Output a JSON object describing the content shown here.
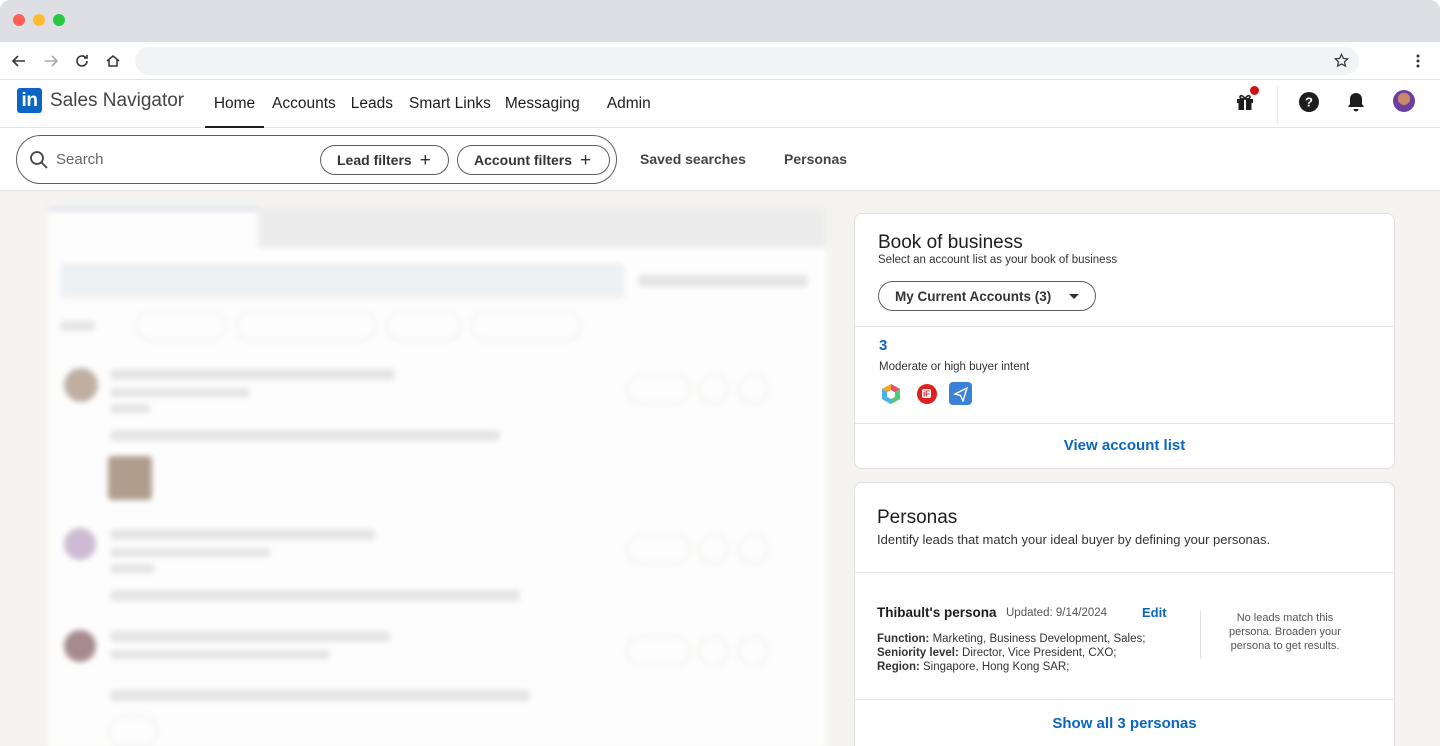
{
  "app": {
    "brand_short": "in",
    "brand_name": "Sales Navigator"
  },
  "nav": {
    "items": [
      {
        "label": "Home",
        "active": true
      },
      {
        "label": "Accounts"
      },
      {
        "label": "Leads"
      },
      {
        "label": "Smart Links"
      },
      {
        "label": "Messaging"
      },
      {
        "label": "Admin"
      }
    ]
  },
  "search": {
    "placeholder": "Search",
    "lead_filters": "Lead filters",
    "account_filters": "Account filters",
    "saved_searches": "Saved searches",
    "personas": "Personas"
  },
  "book_of_business": {
    "title": "Book of business",
    "subtitle": "Select an account list as your book of business",
    "dropdown_value": "My Current Accounts (3)",
    "count": "3",
    "intent_label": "Moderate or high buyer intent",
    "view_link": "View account list"
  },
  "personas_card": {
    "title": "Personas",
    "subtitle": "Identify leads that match your ideal buyer by defining your personas.",
    "persona_name": "Thibault's persona",
    "updated": "Updated: 9/14/2024",
    "edit": "Edit",
    "function_label": "Function:",
    "function_value": "Marketing, Business Development, Sales;",
    "seniority_label": "Seniority level:",
    "seniority_value": "Director, Vice President, CXO;",
    "region_label": "Region:",
    "region_value": "Singapore, Hong Kong SAR;",
    "empty_message": "No leads match this persona. Broaden your persona to get results.",
    "show_all": "Show all 3 personas"
  },
  "colors": {
    "brand_blue": "#0a66c2",
    "notification_red": "#cc1016"
  }
}
